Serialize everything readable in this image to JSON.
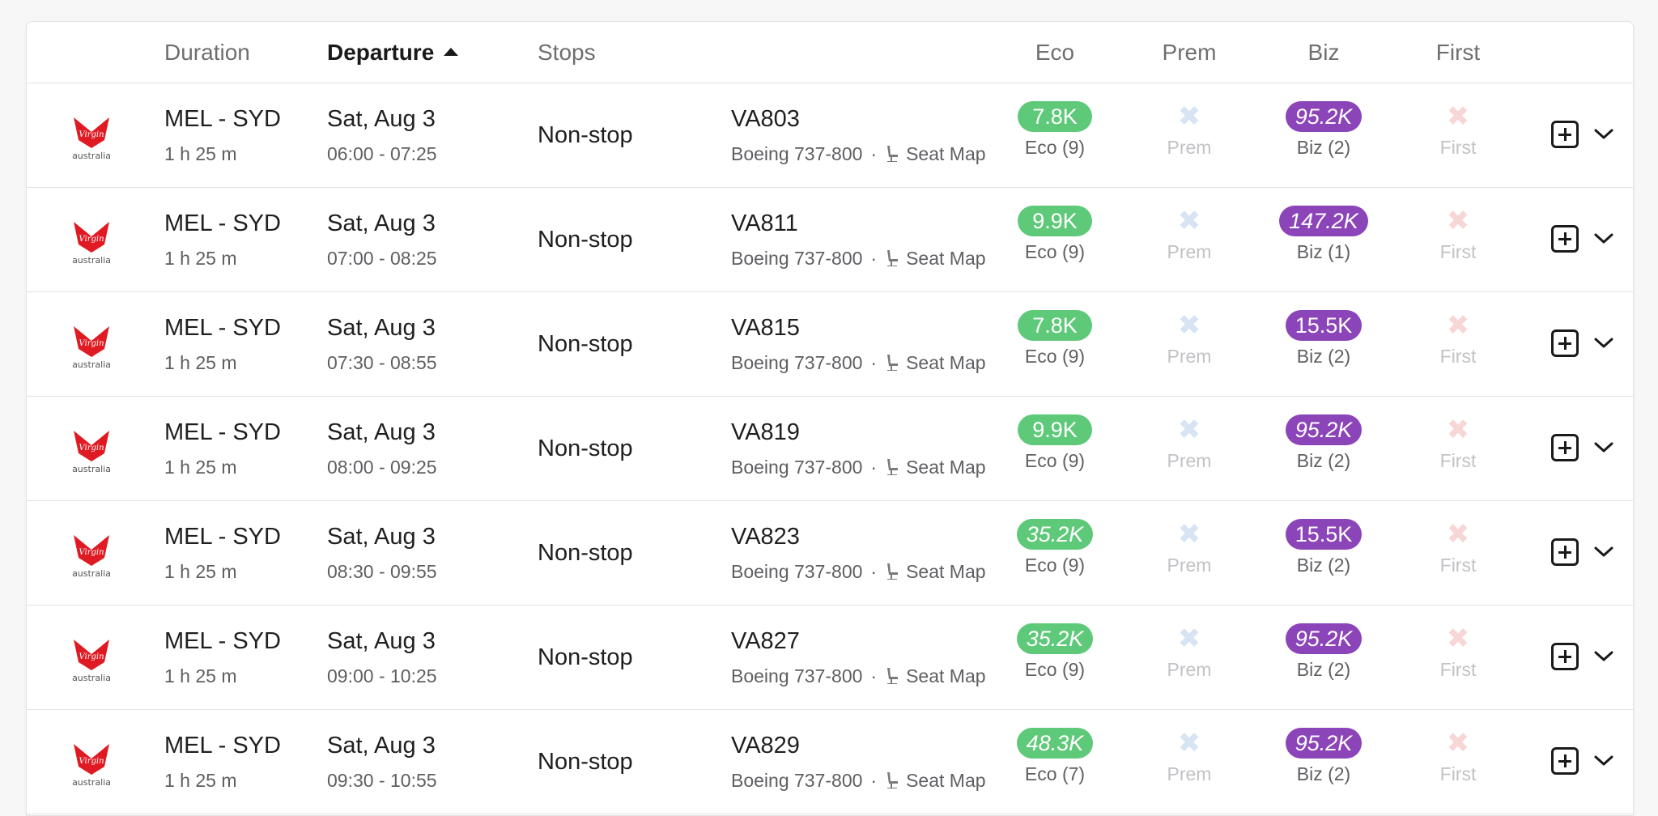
{
  "header": {
    "duration": "Duration",
    "departure": "Departure",
    "stops": "Stops",
    "eco": "Eco",
    "prem": "Prem",
    "biz": "Biz",
    "first": "First"
  },
  "colors": {
    "eco_pill": "#5fc97a",
    "biz_pill": "#8b45b8",
    "prem_unavailable": "#d6e4f3",
    "first_unavailable": "#f7d6d6",
    "airline_red": "#e01a22"
  },
  "flights": [
    {
      "route": "MEL - SYD",
      "duration": "1 h 25 m",
      "date": "Sat, Aug 3",
      "times": "06:00 - 07:25",
      "stops": "Non-stop",
      "flight": "VA803",
      "aircraft": "Boeing 737-800",
      "seatmap": "Seat Map",
      "eco_price": "7.8K",
      "eco_italic": false,
      "eco_seats": "Eco (9)",
      "prem_label": "Prem",
      "biz_price": "95.2K",
      "biz_italic": true,
      "biz_seats": "Biz (2)",
      "first_label": "First"
    },
    {
      "route": "MEL - SYD",
      "duration": "1 h 25 m",
      "date": "Sat, Aug 3",
      "times": "07:00 - 08:25",
      "stops": "Non-stop",
      "flight": "VA811",
      "aircraft": "Boeing 737-800",
      "seatmap": "Seat Map",
      "eco_price": "9.9K",
      "eco_italic": false,
      "eco_seats": "Eco (9)",
      "prem_label": "Prem",
      "biz_price": "147.2K",
      "biz_italic": true,
      "biz_seats": "Biz (1)",
      "first_label": "First"
    },
    {
      "route": "MEL - SYD",
      "duration": "1 h 25 m",
      "date": "Sat, Aug 3",
      "times": "07:30 - 08:55",
      "stops": "Non-stop",
      "flight": "VA815",
      "aircraft": "Boeing 737-800",
      "seatmap": "Seat Map",
      "eco_price": "7.8K",
      "eco_italic": false,
      "eco_seats": "Eco (9)",
      "prem_label": "Prem",
      "biz_price": "15.5K",
      "biz_italic": false,
      "biz_seats": "Biz (2)",
      "first_label": "First"
    },
    {
      "route": "MEL - SYD",
      "duration": "1 h 25 m",
      "date": "Sat, Aug 3",
      "times": "08:00 - 09:25",
      "stops": "Non-stop",
      "flight": "VA819",
      "aircraft": "Boeing 737-800",
      "seatmap": "Seat Map",
      "eco_price": "9.9K",
      "eco_italic": false,
      "eco_seats": "Eco (9)",
      "prem_label": "Prem",
      "biz_price": "95.2K",
      "biz_italic": true,
      "biz_seats": "Biz (2)",
      "first_label": "First"
    },
    {
      "route": "MEL - SYD",
      "duration": "1 h 25 m",
      "date": "Sat, Aug 3",
      "times": "08:30 - 09:55",
      "stops": "Non-stop",
      "flight": "VA823",
      "aircraft": "Boeing 737-800",
      "seatmap": "Seat Map",
      "eco_price": "35.2K",
      "eco_italic": true,
      "eco_seats": "Eco (9)",
      "prem_label": "Prem",
      "biz_price": "15.5K",
      "biz_italic": false,
      "biz_seats": "Biz (2)",
      "first_label": "First"
    },
    {
      "route": "MEL - SYD",
      "duration": "1 h 25 m",
      "date": "Sat, Aug 3",
      "times": "09:00 - 10:25",
      "stops": "Non-stop",
      "flight": "VA827",
      "aircraft": "Boeing 737-800",
      "seatmap": "Seat Map",
      "eco_price": "35.2K",
      "eco_italic": true,
      "eco_seats": "Eco (9)",
      "prem_label": "Prem",
      "biz_price": "95.2K",
      "biz_italic": true,
      "biz_seats": "Biz (2)",
      "first_label": "First"
    },
    {
      "route": "MEL - SYD",
      "duration": "1 h 25 m",
      "date": "Sat, Aug 3",
      "times": "09:30 - 10:55",
      "stops": "Non-stop",
      "flight": "VA829",
      "aircraft": "Boeing 737-800",
      "seatmap": "Seat Map",
      "eco_price": "48.3K",
      "eco_italic": true,
      "eco_seats": "Eco (7)",
      "prem_label": "Prem",
      "biz_price": "95.2K",
      "biz_italic": true,
      "biz_seats": "Biz (2)",
      "first_label": "First"
    }
  ]
}
